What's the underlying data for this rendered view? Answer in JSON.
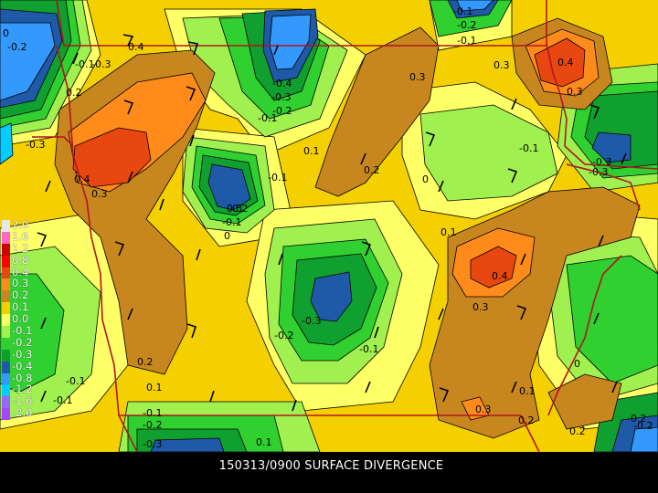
{
  "caption": "150313/0900 SURFACE DIVERGENCE",
  "legend": [
    {
      "label": "2.0",
      "color": "#e8e8e8"
    },
    {
      "label": "1.6",
      "color": "#ff66cc"
    },
    {
      "label": "1.2",
      "color": "#cc0000"
    },
    {
      "label": "0.8",
      "color": "#ff0000"
    },
    {
      "label": "0.4",
      "color": "#e84810"
    },
    {
      "label": "0.3",
      "color": "#ff8c1a"
    },
    {
      "label": "0.2",
      "color": "#c8861e"
    },
    {
      "label": "0.1",
      "color": "#f5d000"
    },
    {
      "label": "0.0",
      "color": "#ffff66"
    },
    {
      "label": "-0.1",
      "color": "#a0f050"
    },
    {
      "label": "-0.2",
      "color": "#30d030"
    },
    {
      "label": "-0.3",
      "color": "#10a030"
    },
    {
      "label": "-0.4",
      "color": "#1e5aa8"
    },
    {
      "label": "-0.8",
      "color": "#3399ff"
    },
    {
      "label": "-1.2",
      "color": "#00ccff"
    },
    {
      "label": "-1.6",
      "color": "#9966ff"
    },
    {
      "label": "-2.0",
      "color": "#aa44ff"
    }
  ],
  "contour_labels": [
    "0",
    "-0.2",
    "-0.1",
    "-0.3",
    "0.3",
    "-0.4",
    "0.2",
    "-0.2",
    "-0.3",
    "-0.1",
    "0.4",
    "0.3",
    "0.1",
    "-0.1",
    "-0.3",
    "0.2",
    "0",
    "-0.1",
    "0.4",
    "0.3",
    "-0.2",
    "0.1",
    "0.3",
    "-0.1",
    "-0.3",
    "0.4",
    "0.3",
    "-0.3",
    "-0.2",
    "-0.1",
    "0",
    "0.2",
    "-0.1",
    "0.1",
    "0",
    "-0.1",
    "0.3",
    "0.1",
    "0.2",
    "-0.2",
    "0.2",
    "-0.1",
    "-0.2",
    "-0.3",
    "0.1",
    "-0.1",
    "-0.1",
    "-0.2",
    "-0.3",
    "0.4",
    "0.3",
    "-0.2"
  ]
}
